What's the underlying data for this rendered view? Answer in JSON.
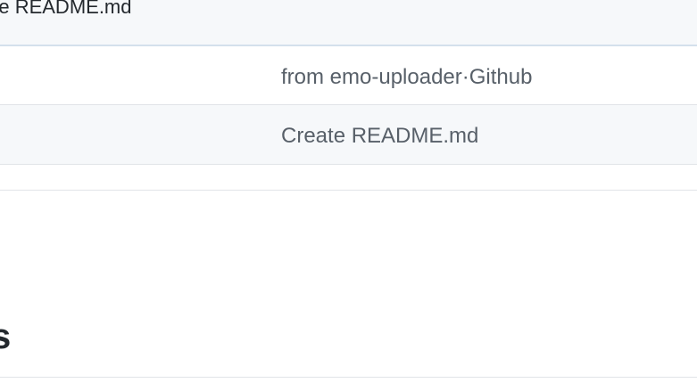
{
  "commit_header": {
    "message": "ate README.md"
  },
  "file_rows": [
    {
      "commit_message": "from emo-uploader·Github"
    },
    {
      "commit_message": "Create README.md"
    }
  ],
  "readme_heading": {
    "text": "s"
  },
  "colors": {
    "header_bg": "#f6f8fa",
    "header_border": "#d4e0ec",
    "row_border": "#e1e4e8",
    "muted_text": "#586069",
    "primary_text": "#24292e"
  }
}
